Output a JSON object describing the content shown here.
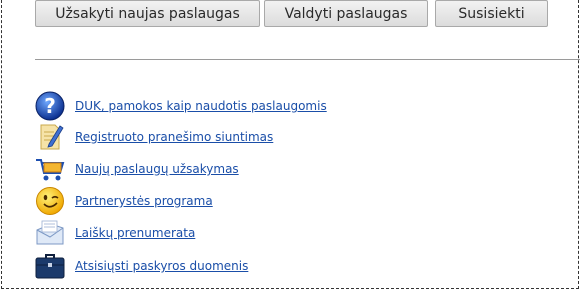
{
  "buttons": {
    "order_services": "Užsakyti naujas paslaugas",
    "manage_services": "Valdyti paslaugas",
    "contact": "Susisiekti"
  },
  "links": [
    {
      "label": "DUK, pamokos kaip naudotis paslaugomis",
      "icon": "help-question-icon"
    },
    {
      "label": "Registruoto pranešimo siuntimas",
      "icon": "document-pen-icon"
    },
    {
      "label": "Naujų paslaugų užsakymas",
      "icon": "shopping-cart-icon"
    },
    {
      "label": "Partnerystės programa",
      "icon": "smiley-wink-icon"
    },
    {
      "label": "Laiškų prenumerata",
      "icon": "newsletter-icon"
    },
    {
      "label": "Atsisiųsti paskyros duomenis",
      "icon": "briefcase-icon"
    }
  ],
  "colors": {
    "link": "#1a4ea8",
    "button_bg": "#e6e6e6",
    "divider": "#9a9a9a"
  }
}
